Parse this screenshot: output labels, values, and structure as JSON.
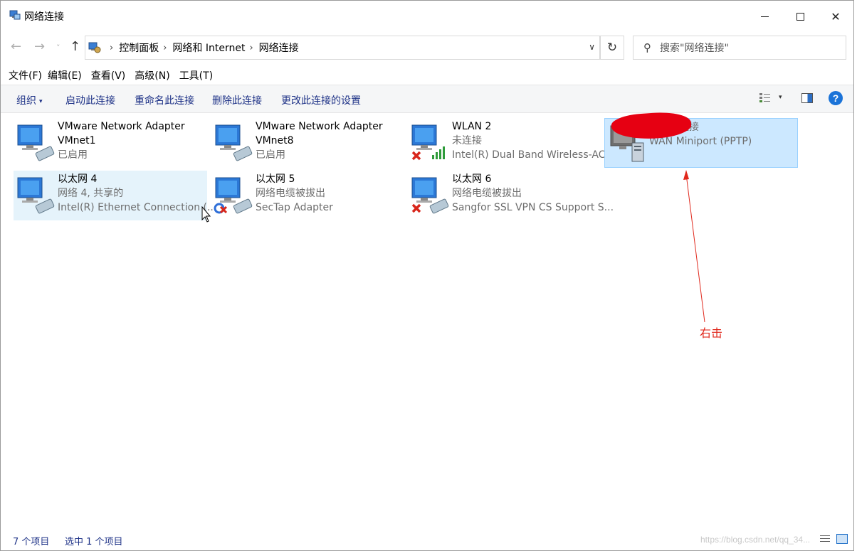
{
  "window": {
    "title": "网络连接",
    "icon": "network-connections-icon"
  },
  "title_buttons": {
    "minimize": "minimize-icon",
    "maximize": "maximize-icon",
    "close_glyph": "✕"
  },
  "nav": {
    "back_glyph": "←",
    "forward_glyph": "→",
    "recent_glyph": "˅",
    "up_glyph": "↑",
    "breadcrumbs": [
      "控制面板",
      "网络和 Internet",
      "网络连接"
    ],
    "breadcrumb_separator": "›",
    "dropdown_glyph": "∨",
    "refresh_glyph": "↻",
    "search_placeholder": "搜索\"网络连接\"",
    "search_glyph": "⚲"
  },
  "menu": {
    "items": [
      "文件(F)",
      "编辑(E)",
      "查看(V)",
      "高级(N)",
      "工具(T)"
    ]
  },
  "commands": {
    "organize": "组织",
    "organize_caret": "▾",
    "start": "启动此连接",
    "rename": "重命名此连接",
    "delete": "删除此连接",
    "change": "更改此连接的设置",
    "view_caret": "▾",
    "help": "?"
  },
  "items": [
    {
      "name": "VMware Network Adapter",
      "name2": "VMnet1",
      "status": "已启用",
      "device": "",
      "badge": "none"
    },
    {
      "name": "VMware Network Adapter",
      "name2": "VMnet8",
      "status": "已启用",
      "device": "",
      "badge": "none"
    },
    {
      "name": "WLAN 2",
      "name2": "",
      "status": "未连接",
      "device": "Intel(R) Dual Band Wireless-AC...",
      "badge": "x-wifi"
    },
    {
      "name": "",
      "name2": "",
      "status": "已断开连接",
      "device": "WAN Miniport (PPTP)",
      "badge": "server"
    },
    {
      "name": "以太网 4",
      "name2": "",
      "status": "网络 4, 共享的",
      "device": "Intel(R) Ethernet Connection (...",
      "badge": "none"
    },
    {
      "name": "以太网 5",
      "name2": "",
      "status": "网络电缆被拔出",
      "device": "SecTap Adapter",
      "badge": "blue-x"
    },
    {
      "name": "以太网 6",
      "name2": "",
      "status": "网络电缆被拔出",
      "device": "Sangfor SSL VPN CS Support S...",
      "badge": "x"
    }
  ],
  "annotation": {
    "text": "右击",
    "color": "#e0281c"
  },
  "status": {
    "count": "7 个项目",
    "selected": "选中 1 个项目",
    "watermark": "https://blog.csdn.net/qq_34..."
  },
  "colors": {
    "command_text": "#1e3287",
    "selected_bg": "#cce8ff",
    "hover_bg": "#e5f3fb",
    "muted_text": "#6d6d6d",
    "redaction": "#e60012"
  }
}
